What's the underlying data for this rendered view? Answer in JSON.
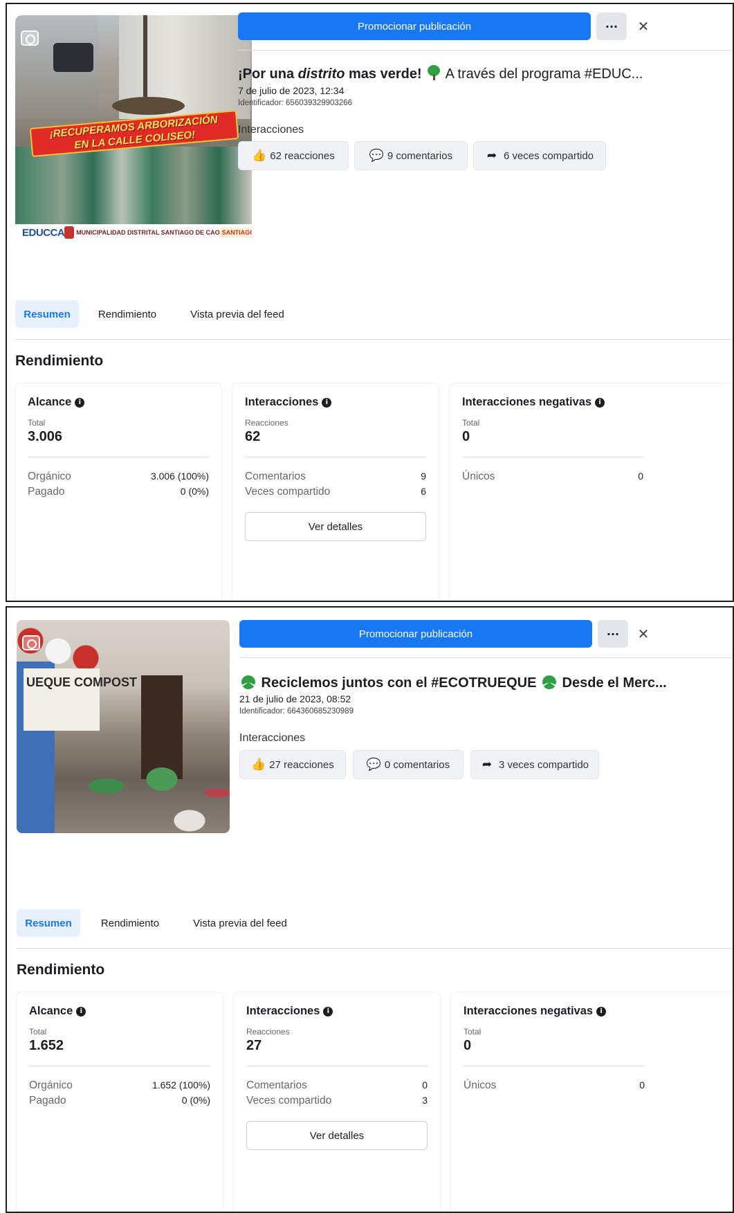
{
  "posts": [
    {
      "promote_label": "Promocionar publicación",
      "more_label": "···",
      "close_label": "✕",
      "title": {
        "prefix": "¡Por una ",
        "italic": "distrito",
        "mid": " mas verde! ",
        "rest": " A través del programa #EDUC..."
      },
      "date": "7 de julio de 2023, 12:34",
      "identifier": "Identificador: 656039329903266",
      "interactions_label": "Interacciones",
      "reactions_pill": "62 reacciones",
      "comments_pill": "9 comentarios",
      "shares_pill": "6 veces compartido",
      "image_text": {
        "banner_line1": "¡RECUPERAMOS ARBORIZACIÓN",
        "banner_line2": "EN LA CALLE COLISEO!",
        "logo_left": "EDUCCA",
        "logo_mid": "MUNICIPALIDAD DISTRITAL SANTIAGO DE CAO",
        "logo_right": "SANTIAGO EL PUEBLO"
      },
      "tabs": [
        "Resumen",
        "Rendimiento",
        "Vista previa del feed"
      ],
      "section_title": "Rendimiento",
      "cards": {
        "reach": {
          "title": "Alcance",
          "sub": "Total",
          "value": "3.006",
          "row1_label": "Orgánico",
          "row1_value": "3.006 (100%)",
          "row2_label": "Pagado",
          "row2_value": "0 (0%)"
        },
        "interactions": {
          "title": "Interacciones",
          "sub": "Reacciones",
          "value": "62",
          "row1_label": "Comentarios",
          "row1_value": "9",
          "row2_label": "Veces compartido",
          "row2_value": "6",
          "button": "Ver detalles"
        },
        "negative": {
          "title": "Interacciones negativas",
          "sub": "Total",
          "value": "0",
          "row1_label": "Únicos",
          "row1_value": "0"
        }
      }
    },
    {
      "promote_label": "Promocionar publicación",
      "more_label": "···",
      "close_label": "✕",
      "title": {
        "prefix": " Reciclemos juntos con el #ECOTRUEQUE ",
        "rest": " Desde el Merc..."
      },
      "date": "21 de julio de 2023, 08:52",
      "identifier": "Identificador: 664360685230989",
      "interactions_label": "Interacciones",
      "reactions_pill": "27 reacciones",
      "comments_pill": "0 comentarios",
      "shares_pill": "3 veces compartido",
      "image_text": {
        "sign": "UEQUE COMPOST"
      },
      "tabs": [
        "Resumen",
        "Rendimiento",
        "Vista previa del feed"
      ],
      "section_title": "Rendimiento",
      "cards": {
        "reach": {
          "title": "Alcance",
          "sub": "Total",
          "value": "1.652",
          "row1_label": "Orgánico",
          "row1_value": "1.652 (100%)",
          "row2_label": "Pagado",
          "row2_value": "0 (0%)"
        },
        "interactions": {
          "title": "Interacciones",
          "sub": "Reacciones",
          "value": "27",
          "row1_label": "Comentarios",
          "row1_value": "0",
          "row2_label": "Veces compartido",
          "row2_value": "3",
          "button": "Ver detalles"
        },
        "negative": {
          "title": "Interacciones negativas",
          "sub": "Total",
          "value": "0",
          "row1_label": "Únicos",
          "row1_value": "0"
        }
      }
    }
  ],
  "icons": {
    "like": "thumbs-up-icon",
    "comment": "comment-icon",
    "share": "share-arrow-icon",
    "info": "info-icon",
    "close": "close-icon",
    "more": "more-dots-icon"
  },
  "colors": {
    "primary": "#1877f2",
    "tab_active_bg": "#e7f0fd",
    "pill_bg": "#f0f2f5",
    "text": "#1c1e21",
    "muted": "#65676b"
  }
}
